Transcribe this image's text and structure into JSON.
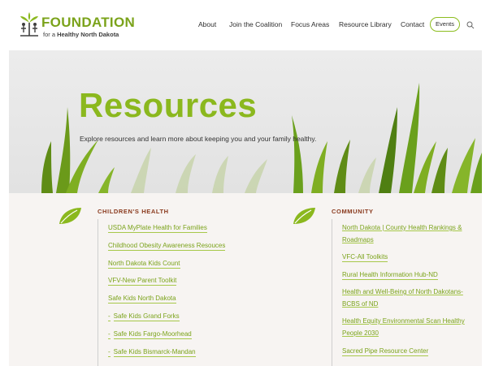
{
  "brand": {
    "title": "FOUNDATION",
    "sub_prefix": "for a ",
    "sub_bold": "Healthy North Dakota",
    "accent": "#8bb81e"
  },
  "nav": {
    "items": [
      "About",
      "Join the Coalition",
      "Focus Areas",
      "Resource Library",
      "Contact"
    ],
    "events_label": "Events",
    "search_icon": "search-icon"
  },
  "hero": {
    "title": "Resources",
    "subtitle": "Explore resources and learn more about keeping you and your family healthy."
  },
  "childrens_health": {
    "heading": "CHILDREN'S HEALTH",
    "links": [
      "USDA MyPlate Health for Families",
      "Childhood Obesity Awareness Resouces",
      "North Dakota Kids Count",
      "VFV-New Parent Toolkit",
      "Safe Kids North Dakota"
    ],
    "sub_links": [
      "Safe Kids Grand Forks",
      "Safe Kids Fargo-Moorhead",
      "Safe Kids Bismarck-Mandan"
    ],
    "dash": "-"
  },
  "community": {
    "heading": "COMMUNITY",
    "links": [
      "North Dakota | County Health Rankings & Roadmaps",
      "VFC-All Toolkits",
      "Rural Health Information Hub-ND",
      "Health and Well-Being of North Dakotans-BCBS of ND",
      "Health Equity Environmental Scan Healthy People 2030",
      "Sacred Pipe Resource Center"
    ]
  }
}
